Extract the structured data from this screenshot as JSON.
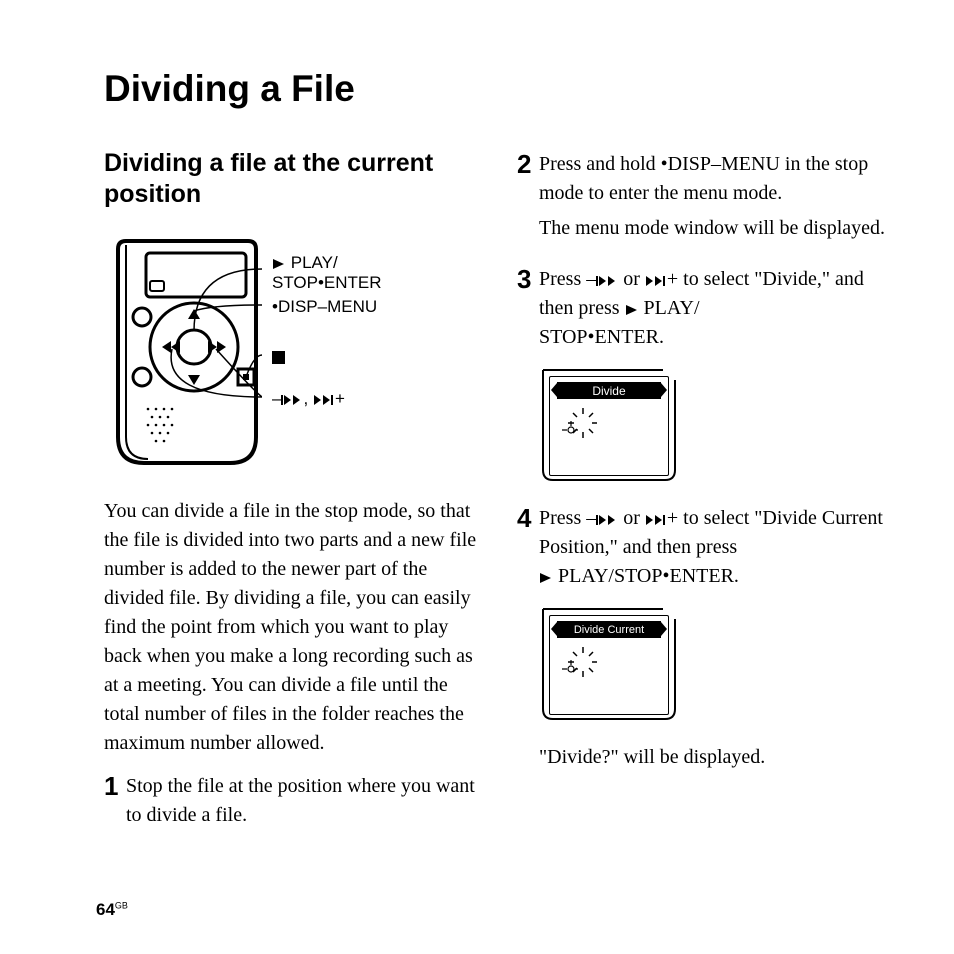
{
  "title": "Dividing a File",
  "section_heading": "Dividing a file at the current position",
  "device_labels": {
    "play_stop_enter_l1": "PLAY/",
    "play_stop_enter_l2": "STOP•ENTER",
    "disp_menu": "•DISP–MENU",
    "stop_square": "",
    "rew_cue_prefix": "–",
    "rew_cue_suffix": "+",
    "rew_cue_sep": ","
  },
  "intro_paragraph": "You can divide a file in the stop mode, so that the file is divided into two parts and a new file number is added to the newer part of the divided file. By dividing a file, you can easily find the point from which you want to play back when you make a long recording such as at a meeting. You can divide a file until the total number of files in the folder reaches the maximum number allowed.",
  "steps": {
    "s1": {
      "num": "1",
      "text": "Stop the file at the position where you want to divide a file."
    },
    "s2": {
      "num": "2",
      "line1": "Press and hold •DISP–MENU in the stop mode to enter the menu mode.",
      "line2": "The menu mode window will be displayed."
    },
    "s3": {
      "num": "3",
      "pre": "Press –",
      "mid": " or ",
      "post1": "+ to select  \"Divide,\" and then press ",
      "post2": " PLAY/",
      "post3": "STOP•ENTER."
    },
    "s4": {
      "num": "4",
      "pre": "Press –",
      "mid": " or ",
      "post1": "+ to select \"Divide Current Position,\" and then press",
      "post2": " PLAY/STOP•ENTER."
    },
    "s4_after": "\"Divide?\" will be displayed."
  },
  "lcd": {
    "divide": "Divide",
    "divide_current": "Divide Current"
  },
  "footer": {
    "page": "64",
    "gb": "GB"
  }
}
